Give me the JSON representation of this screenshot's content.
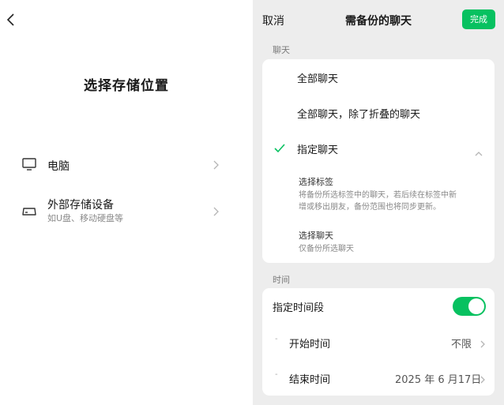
{
  "left_panel": {
    "title": "选择存储位置",
    "options": [
      {
        "label": "电脑",
        "icon": "monitor-icon"
      },
      {
        "label": "外部存储设备",
        "sublabel": "如U盘、移动硬盘等",
        "icon": "external-drive-icon"
      }
    ]
  },
  "right_panel": {
    "cancel_label": "取消",
    "title": "需备份的聊天",
    "done_label": "完成",
    "chat_section": {
      "label": "聊天",
      "options": [
        {
          "label": "全部聊天",
          "selected": false
        },
        {
          "label": "全部聊天，除了折叠的聊天",
          "selected": false
        },
        {
          "label": "指定聊天",
          "selected": true,
          "expanded": true
        }
      ],
      "sub_options": [
        {
          "title": "选择标签",
          "desc_line1": "将备份所选标签中的聊天，若后续在标签中新",
          "desc_line2": "增或移出朋友，备份范围也将同步更新。"
        },
        {
          "title": "选择聊天",
          "desc_line1": "仅备份所选聊天"
        }
      ]
    },
    "time_section": {
      "label": "时间",
      "toggle_label": "指定时间段",
      "toggle_on": true,
      "start_label": "开始时间",
      "start_value": "不限",
      "end_label": "结束时间",
      "end_value": "2025 年 6 月17日"
    }
  },
  "colors": {
    "accent": "#07c160",
    "right_background": "#ededed",
    "card_background": "#ffffff"
  }
}
